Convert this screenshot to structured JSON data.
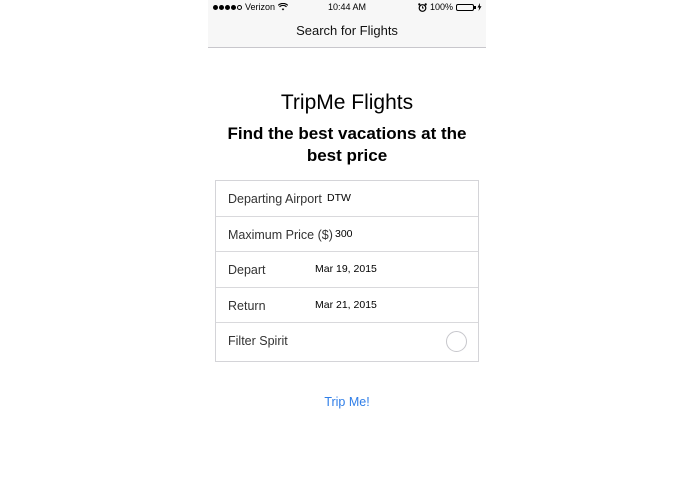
{
  "status_bar": {
    "carrier": "Verizon",
    "time": "10:44 AM",
    "battery": "100%",
    "battery_color": "#4cd964"
  },
  "nav": {
    "title": "Search for Flights"
  },
  "header": {
    "title": "TripMe Flights",
    "subtitle": "Find the best vacations at the best price"
  },
  "form": {
    "departing_airport": {
      "label": "Departing Airport",
      "value": "DTW"
    },
    "maximum_price": {
      "label": "Maximum Price ($)",
      "value": "300"
    },
    "depart": {
      "label": "Depart",
      "value": "Mar 19, 2015"
    },
    "return": {
      "label": "Return",
      "value": "Mar 21, 2015"
    },
    "filter_spirit": {
      "label": "Filter Spirit",
      "checked": false
    }
  },
  "action": {
    "label": "Trip Me!",
    "color": "#2f7ee8"
  }
}
